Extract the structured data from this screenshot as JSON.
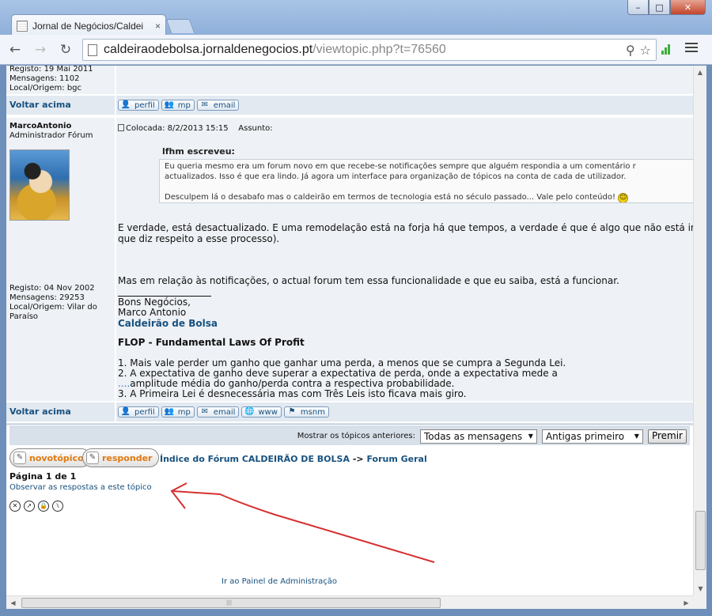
{
  "browser": {
    "tab_title": "Jornal de Negócios/Caldei",
    "tab_close": "×",
    "url_host": "caldeiraodebolsa.jornaldenegocios.pt",
    "url_path": "/viewtopic.php?t=76560",
    "window_min": "–",
    "window_max": "□",
    "window_close": "✕",
    "back": "←",
    "forward": "→",
    "reload": "↻"
  },
  "prev_post": {
    "registo": "Registo: 19 Mai 2011",
    "mensagens": "Mensagens: 1102",
    "local": "Local/Origem: bgc",
    "voltar": "Voltar acima",
    "buttons": [
      "perfil",
      "mp",
      "email"
    ]
  },
  "post": {
    "author": "MarcoAntonio",
    "rank": "Administrador Fórum",
    "registo": "Registo: 04 Nov 2002",
    "mensagens": "Mensagens: 29253",
    "local_1": "Local/Origem: Vilar do",
    "local_2": "Paraíso",
    "colocada": "Colocada: 8/2/2013 15:15",
    "assunto": "Assunto:",
    "quote_author": "lfhm escreveu:",
    "quote_line1": "Eu queria mesmo era um forum novo em que recebe-se notificações sempre que alguém respondia a um comentário r",
    "quote_line2": "actualizados. Isso é que era lindo. Já agora um interface para organização de tópicos na conta de cada de utilizador.",
    "quote_line3": "Desculpem lá o desabafo mas o caldeirão em termos de tecnologia está no século passado... Vale pelo conteúdo!",
    "body_line1": "É verdade, está desactualizado. E uma remodelação está na forja há que tempos, a verdade é que é algo que não está inteira",
    "body_line2": "que diz respeito a esse processo).",
    "body_line3": "Mas em relação às notificações, o actual forum tem essa funcionalidade e que eu saiba, está a funcionar.",
    "sig_line1": "Bons Negócios,",
    "sig_line2": "Marco Antonio",
    "sig_link": "Caldeirão de Bolsa",
    "flop_title": "FLOP - Fundamental Laws Of Profit",
    "flop_1": "1. Mais vale perder um ganho que ganhar uma perda, a menos que se cumpra a Segunda Lei.",
    "flop_2a": "2. A expectativa de ganho deve superar a expectativa de perda, onde a expectativa mede a",
    "flop_2b_dots": "....",
    "flop_2b": "amplitude média do ganho/perda contra a respectiva probabilidade.",
    "flop_3": "3. A Primeira Lei é desnecessária mas com Três Leis isto ficava mais giro.",
    "voltar": "Voltar acima",
    "buttons": [
      "perfil",
      "mp",
      "email",
      "www",
      "msnm"
    ]
  },
  "controls": {
    "mostrar_label": "Mostrar os tópicos anteriores:",
    "select_periodo": "Todas as mensagens",
    "select_ordem": "Antigas primeiro",
    "go_button": "Premir"
  },
  "actions": {
    "novo_topico": "novotópico",
    "responder": "responder",
    "crumb_index": "Índice do Fórum CALDEIRÃO DE BOLSA",
    "crumb_sep": "->",
    "crumb_forum": "Forum Geral",
    "page_info": "Página 1 de 1",
    "watch_link": "Observar as respostas a este tópico",
    "mod_icons": [
      "delete-topic-icon",
      "move-topic-icon",
      "lock-topic-icon",
      "split-topic-icon"
    ],
    "admin_link": "Ir ao Painel de Administração"
  },
  "colors": {
    "link": "#17517f",
    "annotation_arrow": "#d63030",
    "row_bg": "#eef1f5"
  }
}
